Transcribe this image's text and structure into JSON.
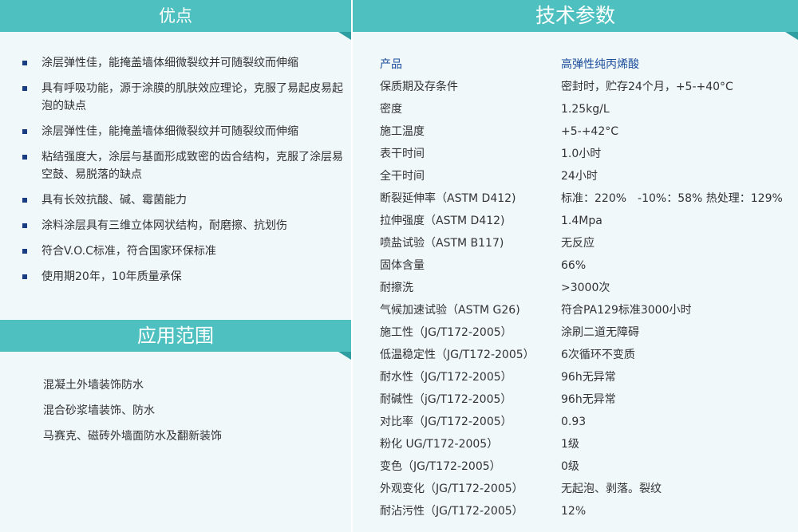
{
  "advantages": {
    "title": "优点",
    "items": [
      "涂层弹性佳，能掩盖墙体细微裂纹并可随裂纹而伸缩",
      "具有呼吸功能，源于涂膜的肌肤效应理论，克服了易起皮易起泡的缺点",
      "涂层弹性佳，能掩盖墙体细微裂纹并可随裂纹而伸缩",
      "粘结强度大，涂层与基面形成致密的齿合结构，克服了涂层易空鼓、易脱落的缺点",
      "具有长效抗酸、碱、霉菌能力",
      "涂料涂层具有三维立体网状结构，耐磨擦、抗划伤",
      "符合V.O.C标准，符合国家环保标准",
      "使用期20年，10年质量承保"
    ]
  },
  "applications": {
    "title": "应用范围",
    "items": [
      "混凝土外墙装饰防水",
      "混合砂浆墙装饰、防水",
      "马赛克、磁砖外墙面防水及翻新装饰"
    ]
  },
  "specs": {
    "title": "技术参数",
    "header": {
      "key": "产品",
      "value": "高弹性纯丙烯酸"
    },
    "rows": [
      {
        "key": "保质期及存条件",
        "value": "密封时，贮存24个月，+5-+40°C"
      },
      {
        "key": "密度",
        "value": "1.25kg/L"
      },
      {
        "key": "施工温度",
        "value": "+5-+42°C"
      },
      {
        "key": "表干时间",
        "value": "1.0小时"
      },
      {
        "key": "全干时间",
        "value": "24小时"
      },
      {
        "key": "断裂延伸率（ASTM D412)",
        "value": "标准：220%　-10%：58%  热处理：129%"
      },
      {
        "key": "拉伸强度（ASTM D412)",
        "value": "1.4Mpa"
      },
      {
        "key": "喷盐试验（ASTM B117)",
        "value": "无反应"
      },
      {
        "key": "固体含量",
        "value": "66%"
      },
      {
        "key": "耐擦洗",
        "value": ">3000次"
      },
      {
        "key": "气候加速试验（ASTM G26)",
        "value": "符合PA129标准3000小时"
      },
      {
        "key": "施工性（JG/T172-2005）",
        "value": "涂刷二道无障碍"
      },
      {
        "key": "低温稳定性（JG/T172-2005）",
        "value": "6次循环不变质"
      },
      {
        "key": "耐水性（JG/T172-2005）",
        "value": "96h无异常"
      },
      {
        "key": "耐碱性（jG/T172-2005）",
        "value": "96h无异常"
      },
      {
        "key": "对比率（JG/T172-2005）",
        "value": "0.93"
      },
      {
        "key": "粉化 UG/T172-2005）",
        "value": "1级"
      },
      {
        "key": "变色（JG/T172-2005）",
        "value": "0级"
      },
      {
        "key": "外观变化（JG/T172-2005）",
        "value": "无起泡、剥落。裂纹"
      },
      {
        "key": "耐沾污性（JG/T172-2005）",
        "value": "12%"
      }
    ]
  }
}
